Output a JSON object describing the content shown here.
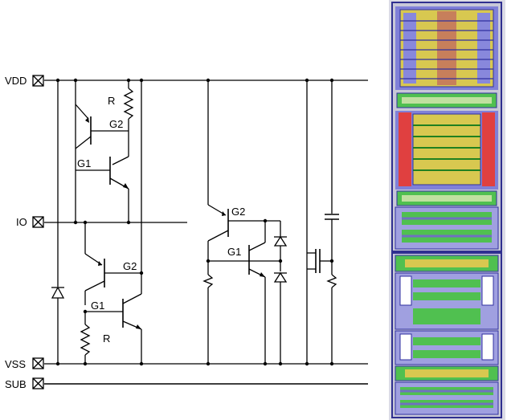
{
  "schematic": {
    "pins": [
      {
        "id": "vdd",
        "label": "VDD"
      },
      {
        "id": "io",
        "label": "IO"
      },
      {
        "id": "vss",
        "label": "VSS"
      },
      {
        "id": "sub",
        "label": "SUB"
      }
    ],
    "labels": {
      "r_top": "R",
      "g2_top": "G2",
      "g1_top": "G1",
      "g2_bot": "G2",
      "g1_bot": "G1",
      "r_bot": "R",
      "g2_mid": "G2",
      "g1_mid": "G1"
    }
  },
  "layout": {
    "colors": {
      "background": "#d8d8e0",
      "frame": "#4a4ac0",
      "poly": "#e0d040",
      "active": "#40b040",
      "metal": "#7070e0",
      "red": "#e03030",
      "border": "#303090"
    }
  }
}
